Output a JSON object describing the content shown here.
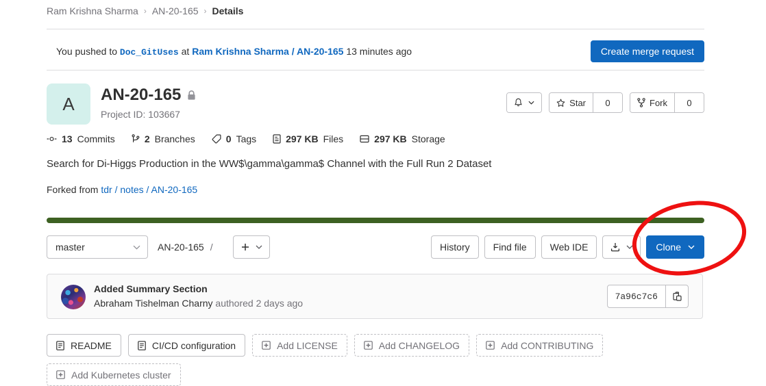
{
  "breadcrumb": {
    "items": [
      {
        "label": "Ram Krishna Sharma",
        "current": false
      },
      {
        "label": "AN-20-165",
        "current": false
      },
      {
        "label": "Details",
        "current": true
      }
    ],
    "separator": "›"
  },
  "push_event": {
    "prefix": "You pushed to",
    "branch": "Doc_GitUses",
    "middle": "at",
    "project": "Ram Krishna Sharma / AN-20-165",
    "time": "13 minutes ago",
    "create_mr_label": "Create merge request"
  },
  "project": {
    "avatar_letter": "A",
    "avatar_bg": "#d4f0ec",
    "name": "AN-20-165",
    "visibility": "private",
    "project_id_label": "Project ID: 103667",
    "notification_icon": "bell-icon",
    "star_label": "Star",
    "star_count": "0",
    "fork_label": "Fork",
    "fork_count": "0"
  },
  "stats": [
    {
      "icon": "commit-icon",
      "value": "13",
      "label": "Commits"
    },
    {
      "icon": "branch-icon",
      "value": "2",
      "label": "Branches"
    },
    {
      "icon": "tag-icon",
      "value": "0",
      "label": "Tags"
    },
    {
      "icon": "file-icon",
      "value": "297 KB",
      "label": "Files"
    },
    {
      "icon": "storage-icon",
      "value": "297 KB",
      "label": "Storage"
    }
  ],
  "description": "Search for Di-Higgs Production in the WW$\\gamma\\gamma$ Channel with the Full Run 2 Dataset",
  "forked": {
    "prefix": "Forked from",
    "source": "tdr / notes / AN-20-165"
  },
  "language_bar": {
    "color": "#3d6122",
    "percent": 100
  },
  "repo_toolbar": {
    "branch": "master",
    "path": "AN-20-165",
    "path_separator": "/",
    "add_label": "+",
    "history_label": "History",
    "find_file_label": "Find file",
    "web_ide_label": "Web IDE",
    "download_icon": "download-icon",
    "clone_label": "Clone"
  },
  "last_commit": {
    "title": "Added Summary Section",
    "author": "Abraham Tishelman Charny",
    "meta": "authored 2 days ago",
    "sha": "7a96c7c6",
    "copy_icon": "clipboard-icon"
  },
  "file_actions": [
    {
      "label": "README",
      "icon": "doc-icon",
      "style": "solid"
    },
    {
      "label": "CI/CD configuration",
      "icon": "doc-icon",
      "style": "solid"
    },
    {
      "label": "Add LICENSE",
      "icon": "plus-box-icon",
      "style": "dashed"
    },
    {
      "label": "Add CHANGELOG",
      "icon": "plus-box-icon",
      "style": "dashed"
    },
    {
      "label": "Add CONTRIBUTING",
      "icon": "plus-box-icon",
      "style": "dashed"
    },
    {
      "label": "Add Kubernetes cluster",
      "icon": "plus-box-icon",
      "style": "dashed"
    }
  ],
  "annotation": {
    "shape": "ellipse",
    "color": "#ee1111",
    "target": "Clone"
  },
  "colors": {
    "primary_blue": "#1068bf",
    "link_blue": "#1068bf",
    "language_green": "#3d6122",
    "annotation_red": "#ee1111",
    "border": "#bfbfc3",
    "text": "#303030",
    "muted": "#737278"
  }
}
